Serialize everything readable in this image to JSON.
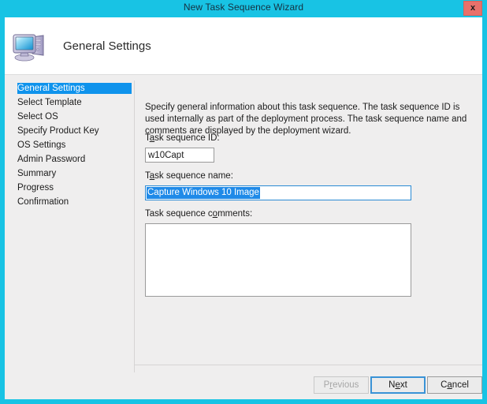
{
  "window": {
    "title": "New Task Sequence Wizard",
    "close_label": "x",
    "accent_color": "#18c3e4",
    "close_color": "#e8716b"
  },
  "header": {
    "title": "General Settings",
    "icon": "computer-monitor-icon"
  },
  "sidebar": {
    "selected_index": 0,
    "highlight_color": "#0f93ec",
    "items": [
      {
        "label": "General Settings"
      },
      {
        "label": "Select Template"
      },
      {
        "label": "Select OS"
      },
      {
        "label": "Specify Product Key"
      },
      {
        "label": "OS Settings"
      },
      {
        "label": "Admin Password"
      },
      {
        "label": "Summary"
      },
      {
        "label": "Progress"
      },
      {
        "label": "Confirmation"
      }
    ]
  },
  "content": {
    "description": "Specify general information about this task sequence.  The task sequence ID is used internally as part of the deployment process.  The task sequence name and comments are displayed by the deployment wizard.",
    "fields": {
      "task_sequence_id": {
        "label_before": "T",
        "label_accel": "a",
        "label_after": "sk sequence ID:",
        "value": "w10Capt",
        "placeholder": ""
      },
      "task_sequence_name": {
        "label_before": "T",
        "label_accel": "a",
        "label_after": "sk sequence name:",
        "value": "Capture Windows 10 Image",
        "placeholder": "",
        "selected": true,
        "selection_color": "#1f8ae8"
      },
      "task_sequence_comments": {
        "label_before": "Task sequence c",
        "label_accel": "o",
        "label_after": "mments:",
        "value": "",
        "placeholder": ""
      }
    }
  },
  "footer": {
    "previous": {
      "before": "P",
      "accel": "r",
      "after": "evious",
      "enabled": false
    },
    "next": {
      "before": "N",
      "accel": "e",
      "after": "xt",
      "enabled": true,
      "is_default": true
    },
    "cancel": {
      "before": "C",
      "accel": "a",
      "after": "ncel",
      "enabled": true
    }
  }
}
